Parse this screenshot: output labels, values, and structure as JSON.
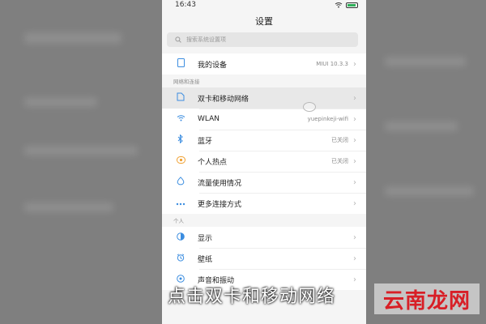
{
  "status_bar": {
    "time": "16:43"
  },
  "header": {
    "title": "设置"
  },
  "search": {
    "placeholder": "搜索系统设置项"
  },
  "my_device": {
    "label": "我的设备",
    "value": "MIUI 10.3.3",
    "icon": "phone-outline-icon"
  },
  "section_network": {
    "label": "网络和连接"
  },
  "network_items": [
    {
      "label": "双卡和移动网络",
      "value": "",
      "icon": "sim-card-icon",
      "icon_color": "#3b8de0",
      "highlighted": true
    },
    {
      "label": "WLAN",
      "value": "yuepinkeji-wifi",
      "icon": "wifi-icon",
      "icon_color": "#3b8de0"
    },
    {
      "label": "蓝牙",
      "value": "已关闭",
      "icon": "bluetooth-icon",
      "icon_color": "#3b8de0"
    },
    {
      "label": "个人热点",
      "value": "已关闭",
      "icon": "hotspot-icon",
      "icon_color": "#f0a030"
    },
    {
      "label": "流量使用情况",
      "value": "",
      "icon": "data-usage-icon",
      "icon_color": "#3b8de0"
    },
    {
      "label": "更多连接方式",
      "value": "",
      "icon": "more-dots-icon",
      "icon_color": "#3b8de0"
    }
  ],
  "section_personal": {
    "label": "个人"
  },
  "personal_items": [
    {
      "label": "显示",
      "value": "",
      "icon": "display-icon",
      "icon_color": "#3b8de0"
    },
    {
      "label": "壁纸",
      "value": "",
      "icon": "wallpaper-icon",
      "icon_color": "#3b8de0"
    },
    {
      "label": "声音和振动",
      "value": "",
      "icon": "sound-icon",
      "icon_color": "#3b8de0"
    }
  ],
  "caption": "点击双卡和移动网络",
  "watermark": "云南龙网"
}
